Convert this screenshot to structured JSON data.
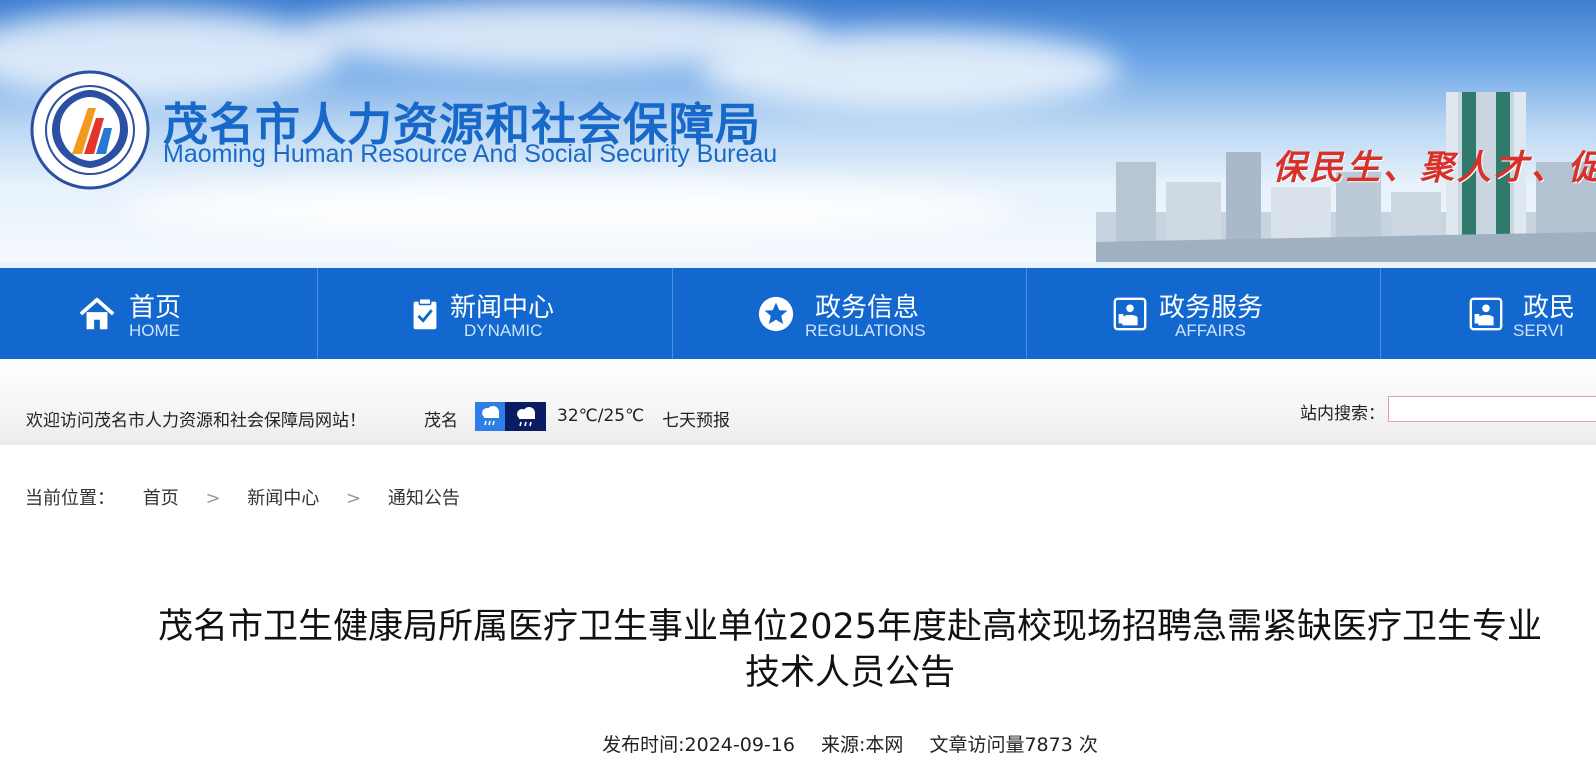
{
  "header": {
    "title_cn": "茂名市人力资源和社会保障局",
    "title_en": "Maoming Human Resource And Social Security Bureau",
    "slogan": "保民生、聚人才、促"
  },
  "nav": {
    "items": [
      {
        "cn": "首页",
        "en": "HOME",
        "icon": "home-icon"
      },
      {
        "cn": "新闻中心",
        "en": "DYNAMIC",
        "icon": "clipboard-check-icon"
      },
      {
        "cn": "政务信息",
        "en": "REGULATIONS",
        "icon": "star-icon"
      },
      {
        "cn": "政务服务",
        "en": "AFFAIRS",
        "icon": "service-icon"
      },
      {
        "cn": "政民",
        "en": "SERVI",
        "icon": "service-icon"
      }
    ]
  },
  "infobar": {
    "welcome": "欢迎访问茂名市人力资源和社会保障局网站！",
    "city": "茂名",
    "weather_icons": [
      "rain-day-icon",
      "rain-night-icon"
    ],
    "temperature": "32℃/25℃",
    "forecast": "七天预报",
    "search_label": "站内搜索："
  },
  "breadcrumb": {
    "label": "当前位置：",
    "items": [
      "首页",
      "新闻中心",
      "通知公告"
    ],
    "separator": ">"
  },
  "article": {
    "title_line1": "茂名市卫生健康局所属医疗卫生事业单位2025年度赴高校现场招聘急需紧缺医疗卫生专业",
    "title_line2": "技术人员公告",
    "published": "发布时间:2024-09-16",
    "source": "来源:本网",
    "views": "文章访问量7873 次"
  },
  "colors": {
    "nav_bg": "#1268cf",
    "title_blue": "#1768c9",
    "slogan_red": "#d8312a"
  }
}
